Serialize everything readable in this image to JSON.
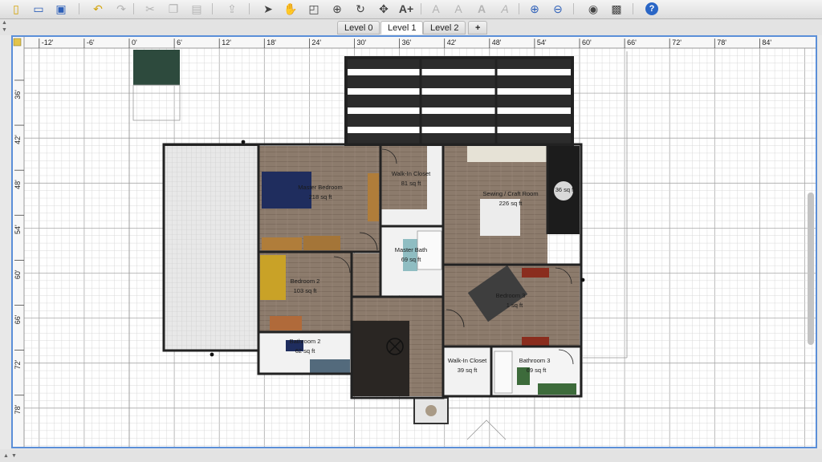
{
  "toolbar": {
    "items": [
      {
        "name": "new-home-icon",
        "glyph": "▯"
      },
      {
        "name": "open-icon",
        "glyph": "▭"
      },
      {
        "name": "save-icon",
        "glyph": "▣"
      },
      {
        "name": "undo-icon",
        "glyph": "↶"
      },
      {
        "name": "redo-icon",
        "glyph": "↷"
      },
      {
        "name": "cut-icon",
        "glyph": "✂"
      },
      {
        "name": "copy-icon",
        "glyph": "❐"
      },
      {
        "name": "paste-icon",
        "glyph": "▤"
      },
      {
        "name": "add-furniture-icon",
        "glyph": "⇪"
      },
      {
        "name": "select-icon",
        "glyph": "➤"
      },
      {
        "name": "pan-icon",
        "glyph": "✋"
      },
      {
        "name": "create-walls-icon",
        "glyph": "◰"
      },
      {
        "name": "create-rooms-icon",
        "glyph": "⊕"
      },
      {
        "name": "create-polylines-icon",
        "glyph": "↻"
      },
      {
        "name": "create-dimensions-icon",
        "glyph": "✥"
      },
      {
        "name": "add-text-icon",
        "glyph": "A+"
      },
      {
        "name": "increase-text-size-icon",
        "glyph": "A"
      },
      {
        "name": "decrease-text-size-icon",
        "glyph": "A"
      },
      {
        "name": "bold-text-icon",
        "glyph": "A"
      },
      {
        "name": "italic-text-icon",
        "glyph": "A"
      },
      {
        "name": "zoom-in-icon",
        "glyph": "⊕"
      },
      {
        "name": "zoom-out-icon",
        "glyph": "⊖"
      },
      {
        "name": "create-photo-icon",
        "glyph": "◉"
      },
      {
        "name": "create-video-icon",
        "glyph": "▩"
      },
      {
        "name": "help-icon",
        "glyph": "?"
      }
    ]
  },
  "levels": {
    "tabs": [
      "Level 0",
      "Level 1",
      "Level 2"
    ],
    "active": "Level 1",
    "add_label": "+"
  },
  "ruler": {
    "top": [
      "-12'",
      "-6'",
      "0'",
      "6'",
      "12'",
      "18'",
      "24'",
      "30'",
      "36'",
      "42'",
      "48'",
      "54'",
      "60'",
      "66'",
      "72'",
      "78'",
      "84'"
    ],
    "left": [
      "36'",
      "42'",
      "48'",
      "54'",
      "60'",
      "66'",
      "72'",
      "78'"
    ]
  },
  "rooms": [
    {
      "name": "Master Bedroom",
      "area": "218 sq ft"
    },
    {
      "name": "Walk-In Closet",
      "area": "81 sq ft"
    },
    {
      "name": "Sewing / Craft Room",
      "area": "226 sq ft"
    },
    {
      "name": "",
      "area": "36 sq ft"
    },
    {
      "name": "Master Bath",
      "area": "69 sq ft"
    },
    {
      "name": "Bedroom 2",
      "area": "103 sq ft"
    },
    {
      "name": "Bedroom 3",
      "area": "1 sq ft"
    },
    {
      "name": "Bathroom 2",
      "area": "62 sq ft"
    },
    {
      "name": "Walk-In Closet",
      "area": "39 sq ft"
    },
    {
      "name": "Bathroom 3",
      "area": "69 sq ft"
    }
  ],
  "colors": {
    "wood_floor": "#8c7b6c",
    "grid": "#d9d9d9",
    "grid_major": "#a8a8a8",
    "wall": "#222222",
    "selection_border": "#5b8fd8"
  }
}
